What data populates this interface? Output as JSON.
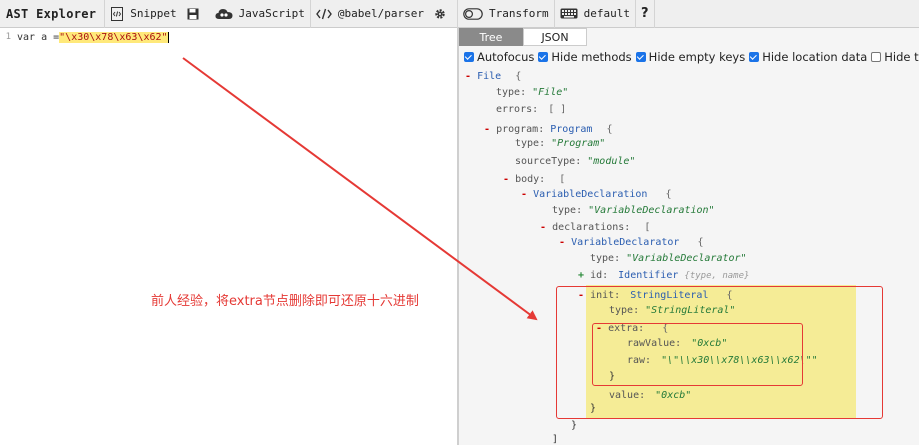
{
  "toolbar": {
    "app_title": "AST Explorer",
    "snippet_label": "Snippet",
    "language_label": "JavaScript",
    "parser_label": "@babel/parser",
    "transform_label": "Transform",
    "keymap_label": "default",
    "help_label": "?"
  },
  "editor": {
    "line_number": "1",
    "code_prefix": "var a = ",
    "code_string": "\"\\x30\\x78\\x63\\x62\""
  },
  "panel": {
    "tabs": [
      {
        "label": "Tree",
        "active": true
      },
      {
        "label": "JSON",
        "active": false
      }
    ],
    "options": [
      {
        "label": "Autofocus",
        "checked": true
      },
      {
        "label": "Hide methods",
        "checked": true
      },
      {
        "label": "Hide empty keys",
        "checked": true
      },
      {
        "label": "Hide location data",
        "checked": true
      },
      {
        "label": "Hide type keys",
        "checked": false
      }
    ]
  },
  "tree": {
    "file_toggle": "-",
    "file_node": "File",
    "open_brace": "{",
    "close_brace": "}",
    "open_bracket": "[",
    "close_bracket": "]",
    "empty_array": "[ ]",
    "type_key": "type:",
    "file_type_val": "\"File\"",
    "errors_key": "errors:",
    "program_key": "program:",
    "program_node": "Program",
    "program_type_val": "\"Program\"",
    "source_type_key": "sourceType:",
    "source_type_val": "\"module\"",
    "body_key": "body:",
    "var_decl_node": "VariableDeclaration",
    "var_decl_type_val": "\"VariableDeclaration\"",
    "declarations_key": "declarations:",
    "var_declarator_node": "VariableDeclarator",
    "var_declarator_type_val": "\"VariableDeclarator\"",
    "id_toggle": "+",
    "id_key": "id:",
    "identifier_node": "Identifier",
    "identifier_meta": "{type, name}",
    "init_key": "init:",
    "string_literal_node": "StringLiteral",
    "string_literal_type_val": "\"StringLiteral\"",
    "extra_key": "extra:",
    "raw_value_key": "rawValue:",
    "raw_value_val": "\"0xcb\"",
    "raw_key": "raw:",
    "raw_val": "\"\\\"\\\\x30\\\\x78\\\\x63\\\\x62\\\"\"",
    "value_key": "value:",
    "value_val": "\"0xcb\""
  },
  "annotation": {
    "text": "前人经验，将extra节点删除即可还原十六进制",
    "color": "#e53935"
  }
}
